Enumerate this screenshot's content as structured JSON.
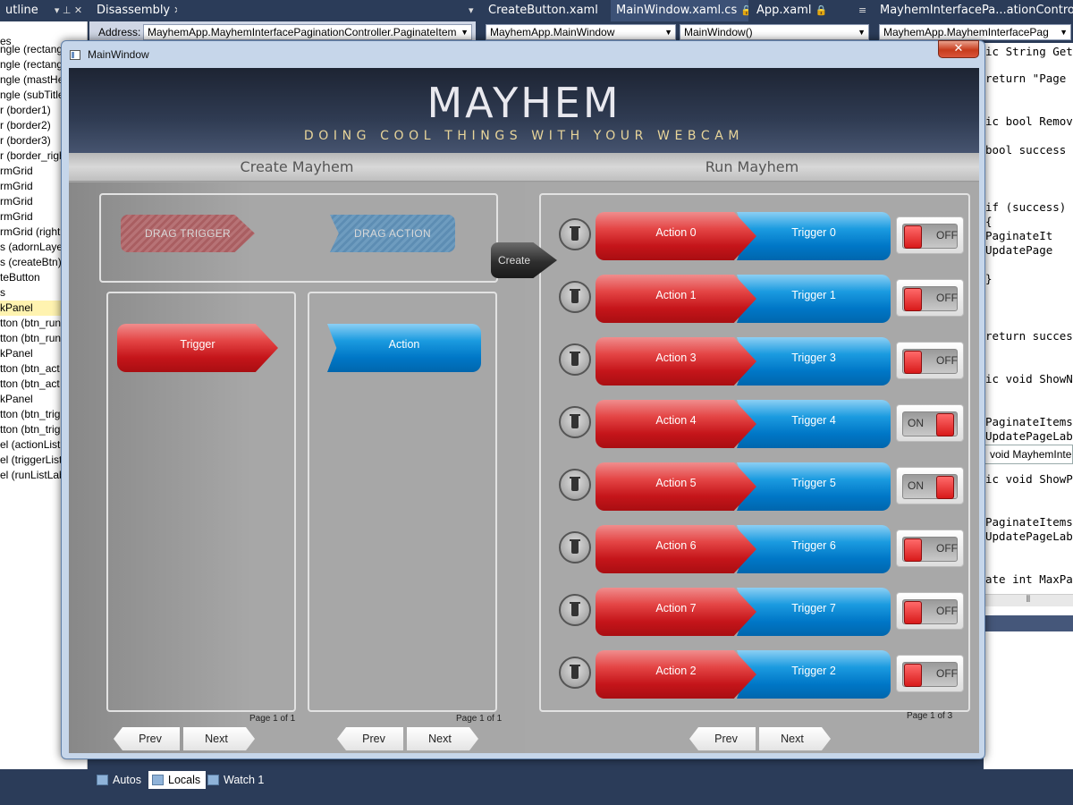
{
  "ide": {
    "tabs": [
      {
        "label": "utline",
        "icons": "▾ ⊥ ✕"
      },
      {
        "label": "Disassembly",
        "icons": "✕"
      },
      {
        "label": "",
        "icons": "▾"
      },
      {
        "label": "CreateButton.xaml",
        "icons": "🔒"
      },
      {
        "label": "MainWindow.xaml.cs",
        "icons": "🔒 ✕"
      },
      {
        "label": "App.xaml",
        "icons": "🔒"
      },
      {
        "label": "",
        "icons": "≡"
      },
      {
        "label": "MayhemInterfacePa...ationController.cs",
        "icons": "🔒"
      }
    ],
    "address_label": "Address:",
    "address_value": "MayhemApp.MayhemInterfacePaginationController.PaginateItem",
    "combo_class": "MayhemApp.MainWindow",
    "combo_member": "MainWindow()",
    "combo_right": "MayhemApp.MayhemInterfacePag",
    "outline_items": [
      "es",
      "ngle (rectang",
      "ngle (rectang",
      "ngle (mastHe",
      "ngle (subTitle",
      "r (border1)",
      "r (border2)",
      "r (border3)",
      "r (border_righ",
      "rmGrid",
      "rmGrid",
      "rmGrid",
      "rmGrid",
      "rmGrid (right!",
      "s (adornLaye",
      "s (createBtn)",
      "teButton",
      "s",
      "kPanel",
      "tton (btn_run",
      "tton (btn_run",
      "kPanel",
      "tton (btn_act",
      "tton (btn_act",
      "kPanel",
      "tton (btn_trig",
      "tton (btn_trig",
      "el (actionListL",
      "el (triggerListl",
      "el (runListLab"
    ],
    "code_lines": [
      "ic String GetP",
      "return \"Page \"",
      "ic bool Remove",
      "bool success =",
      "if (success)",
      "{",
      "  PaginateIt",
      "  UpdatePage",
      "}",
      "return success",
      "ic void ShowNe",
      "PaginateItems(",
      "UpdatePageLabe",
      "ic void ShowPr",
      "PaginateItems(",
      "UpdatePageLabe",
      "ate int MaxPag"
    ],
    "code_tooltip": "void MayhemInte",
    "bottom_tabs": [
      "Autos",
      "Locals",
      "Watch 1"
    ],
    "active_bottom_tab": "Locals"
  },
  "window": {
    "title": "MainWindow",
    "close_label": "✕"
  },
  "header": {
    "title": "MAYHEM",
    "subtitle": "DOING COOL THINGS WITH YOUR WEBCAM"
  },
  "left": {
    "section_title": "Create Mayhem",
    "drag_trigger_label": "DRAG TRIGGER",
    "drag_action_label": "DRAG ACTION",
    "trigger_list": {
      "items": [
        "Trigger"
      ],
      "page_label": "Page 1 of 1",
      "prev": "Prev",
      "next": "Next"
    },
    "action_list": {
      "items": [
        "Action"
      ],
      "page_label": "Page 1 of 1",
      "prev": "Prev",
      "next": "Next"
    }
  },
  "create_label": "Create",
  "right": {
    "section_title": "Run Mayhem",
    "page_label": "Page 1 of 3",
    "prev": "Prev",
    "next": "Next",
    "rows": [
      {
        "action": "Action 0",
        "trigger": "Trigger 0",
        "state": "OFF"
      },
      {
        "action": "Action 1",
        "trigger": "Trigger 1",
        "state": "OFF"
      },
      {
        "action": "Action 3",
        "trigger": "Trigger 3",
        "state": "OFF"
      },
      {
        "action": "Action 4",
        "trigger": "Trigger 4",
        "state": "ON"
      },
      {
        "action": "Action 5",
        "trigger": "Trigger 5",
        "state": "ON"
      },
      {
        "action": "Action 6",
        "trigger": "Trigger 6",
        "state": "OFF"
      },
      {
        "action": "Action 7",
        "trigger": "Trigger 7",
        "state": "OFF"
      },
      {
        "action": "Action 2",
        "trigger": "Trigger 2",
        "state": "OFF"
      }
    ]
  },
  "colors": {
    "trigger_red": "#d8262b",
    "action_blue": "#0a8ad6",
    "ide_navy": "#2b3c59",
    "header_gold": "#e8d59a"
  }
}
